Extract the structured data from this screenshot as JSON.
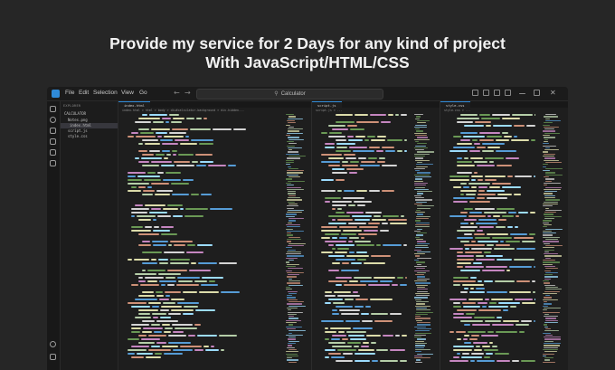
{
  "headline": {
    "line1": "Provide my service for 2 Days for any kind of project",
    "line2": "With JavaScript/HTML/CSS"
  },
  "window": {
    "menu": [
      "File",
      "Edit",
      "Selection",
      "View",
      "Go"
    ],
    "search_placeholder": "Calculator",
    "search_icon": "search-icon"
  },
  "explorer": {
    "header": "EXPLORER",
    "folder": "CALCULATOR",
    "files": [
      {
        "name": "Notes.png",
        "selected": false
      },
      {
        "name": "index.html",
        "selected": true
      },
      {
        "name": "script.js",
        "selected": false
      },
      {
        "name": "style.css",
        "selected": false
      }
    ]
  },
  "panes": [
    {
      "tab": "index.html",
      "crumb": "index.html > html > body > div#calculator.background > div.hidden..."
    },
    {
      "tab": "script.js",
      "crumb": "script.js > ..."
    },
    {
      "tab": "style.css",
      "crumb": "style.css > ..."
    }
  ],
  "colors": {
    "background": "#262626",
    "editor": "#1e1e1e",
    "accent": "#2f8ad8",
    "tag": "#569cd6",
    "attr": "#9cdcfe",
    "string": "#ce9178",
    "keyword": "#c586c0",
    "func": "#dcdcaa",
    "comment": "#6a9955",
    "number": "#b5cea8",
    "text": "#d4d4d4"
  }
}
